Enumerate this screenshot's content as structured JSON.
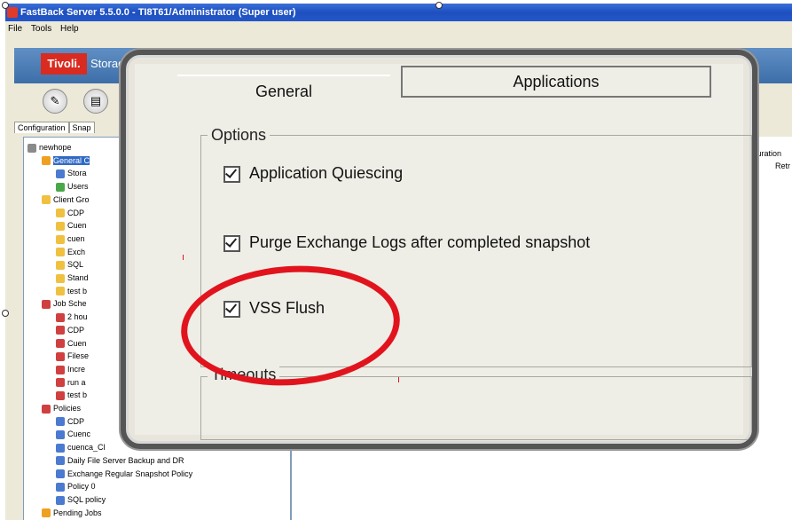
{
  "app": {
    "title": "FastBack Server 5.5.0.0 - TI8T61/Administrator (Super user)",
    "menu": [
      "File",
      "Tools",
      "Help"
    ],
    "brand": "Tivoli.",
    "product": "Storag"
  },
  "left_tabs": [
    "Configuration",
    "Snap"
  ],
  "tree": [
    {
      "label": "newhope",
      "icon_color": "#8a8a8a",
      "indent": 0
    },
    {
      "label": "General C",
      "icon_color": "#f0a020",
      "indent": 1,
      "selected": true
    },
    {
      "label": "Stora",
      "icon_color": "#4a7bd0",
      "indent": 2
    },
    {
      "label": "Users",
      "icon_color": "#4aa84a",
      "indent": 2
    },
    {
      "label": "Client Gro",
      "icon_color": "#f0c040",
      "indent": 1
    },
    {
      "label": "CDP",
      "icon_color": "#f0c040",
      "indent": 2
    },
    {
      "label": "Cuen",
      "icon_color": "#f0c040",
      "indent": 2
    },
    {
      "label": "cuen",
      "icon_color": "#f0c040",
      "indent": 2
    },
    {
      "label": "Exch",
      "icon_color": "#f0c040",
      "indent": 2
    },
    {
      "label": "SQL",
      "icon_color": "#f0c040",
      "indent": 2
    },
    {
      "label": "Stand",
      "icon_color": "#f0c040",
      "indent": 2
    },
    {
      "label": "test b",
      "icon_color": "#f0c040",
      "indent": 2
    },
    {
      "label": "Job Sche",
      "icon_color": "#d04040",
      "indent": 1
    },
    {
      "label": "2 hou",
      "icon_color": "#d04040",
      "indent": 2
    },
    {
      "label": "CDP",
      "icon_color": "#d04040",
      "indent": 2
    },
    {
      "label": "Cuen",
      "icon_color": "#d04040",
      "indent": 2
    },
    {
      "label": "Filese",
      "icon_color": "#d04040",
      "indent": 2
    },
    {
      "label": "Incre",
      "icon_color": "#d04040",
      "indent": 2
    },
    {
      "label": "run a",
      "icon_color": "#d04040",
      "indent": 2
    },
    {
      "label": "test b",
      "icon_color": "#d04040",
      "indent": 2
    },
    {
      "label": "Policies",
      "icon_color": "#d04040",
      "indent": 1
    },
    {
      "label": "CDP",
      "icon_color": "#4a7bd0",
      "indent": 2
    },
    {
      "label": "Cuenc",
      "icon_color": "#4a7bd0",
      "indent": 2
    },
    {
      "label": "cuenca_Cl",
      "icon_color": "#4a7bd0",
      "indent": 2
    },
    {
      "label": "Daily File Server Backup and DR",
      "icon_color": "#4a7bd0",
      "indent": 2
    },
    {
      "label": "Exchange Regular Snapshot Policy",
      "icon_color": "#4a7bd0",
      "indent": 2
    },
    {
      "label": "Policy 0",
      "icon_color": "#4a7bd0",
      "indent": 2
    },
    {
      "label": "SQL policy",
      "icon_color": "#4a7bd0",
      "indent": 2
    },
    {
      "label": "Pending Jobs",
      "icon_color": "#f0a020",
      "indent": 1
    }
  ],
  "right_pane": {
    "label1": "nfiguration",
    "label2": "Retr"
  },
  "zoom": {
    "tabs": [
      "General",
      "Applications"
    ],
    "options_title": "Options",
    "checkboxes": [
      {
        "label": "Application Quiescing",
        "checked": true
      },
      {
        "label": "Purge Exchange Logs after completed snapshot",
        "checked": true
      },
      {
        "label": "VSS Flush",
        "checked": true
      }
    ],
    "timeouts_title": "Timeouts"
  },
  "highlight_color": "#e1141e"
}
